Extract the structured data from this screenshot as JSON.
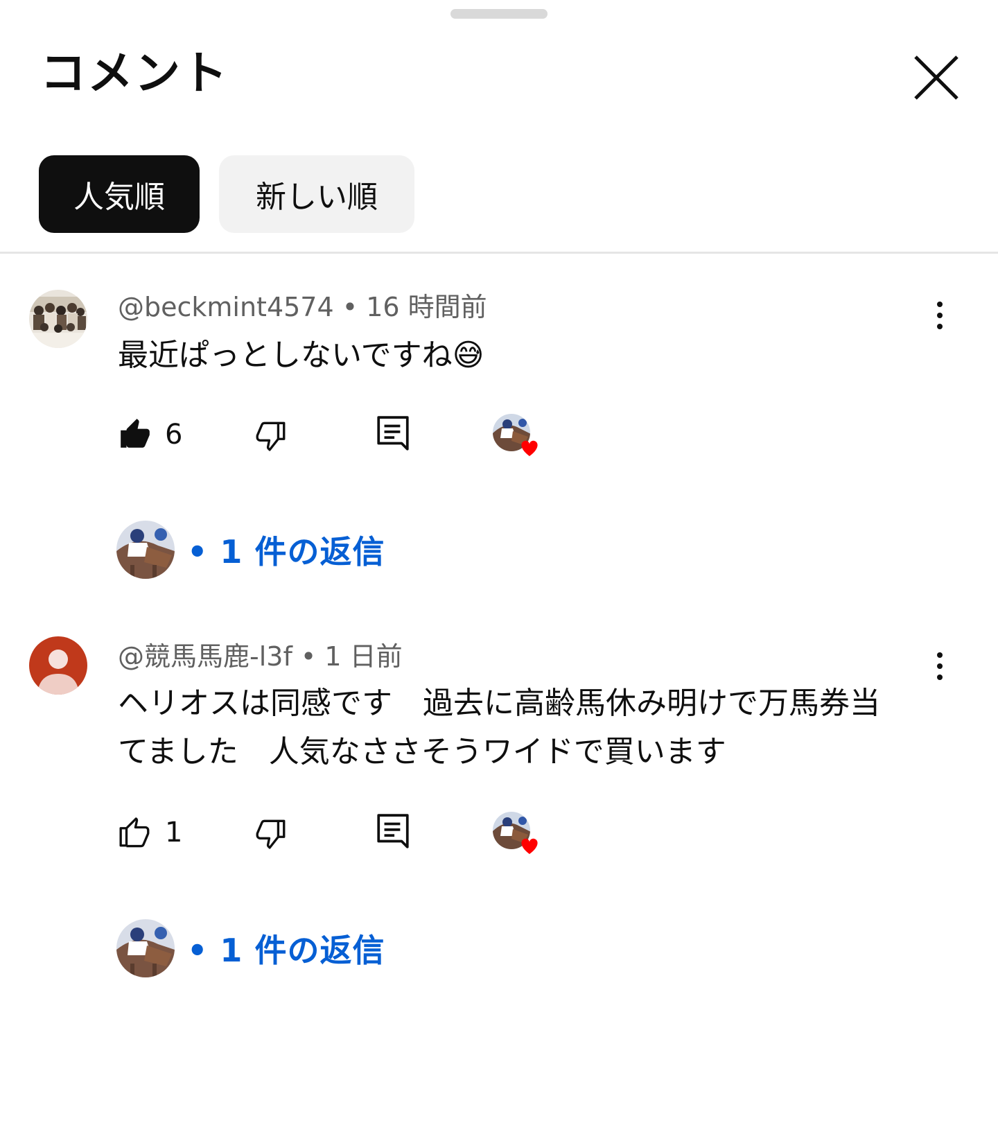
{
  "header": {
    "title": "コメント"
  },
  "sort_tabs": [
    {
      "label": "人気順",
      "selected": true
    },
    {
      "label": "新しい順",
      "selected": false
    }
  ],
  "comments": [
    {
      "meta": "@beckmint4574 • 16 時間前",
      "text": "最近ぱっとしないですね😅",
      "likes": "6",
      "liked": true,
      "replies_label": "• 1 件の返信"
    },
    {
      "meta": "@競馬馬鹿-l3f • 1 日前",
      "text": "ヘリオスは同感です　過去に高齢馬休み明けで万馬券当てました　人気なささそうワイドで買います",
      "likes": "1",
      "liked": false,
      "replies_label": "• 1 件の返信"
    }
  ],
  "colors": {
    "accent_blue": "#065fd4",
    "heart_red": "#ff0000",
    "default_avatar": "#c0391b"
  }
}
